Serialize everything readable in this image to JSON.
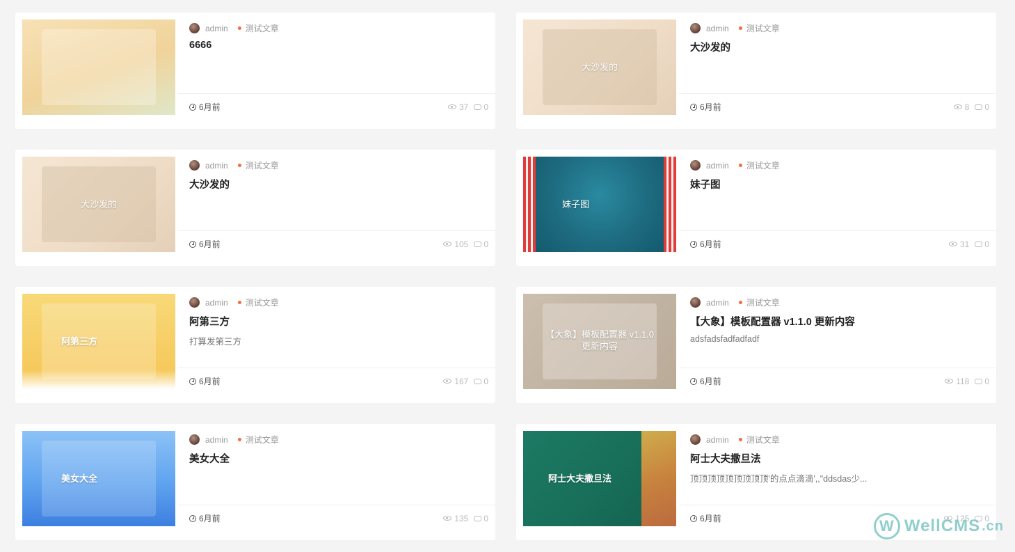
{
  "posts": [
    {
      "thumb_text": "6666",
      "author": "admin",
      "category": "测试文章",
      "title": "6666",
      "excerpt": "",
      "time": "6月前",
      "views": "37",
      "comments": "0",
      "bg": "#f7e1b5",
      "bg2": "#dfe7c8"
    },
    {
      "thumb_text": "大沙发的",
      "author": "admin",
      "category": "测试文章",
      "title": "大沙发的",
      "excerpt": "",
      "time": "6月前",
      "views": "8",
      "comments": "0",
      "bg": "#f5e6d4",
      "bg2": "#eddcc4"
    },
    {
      "thumb_text": "大沙发的",
      "author": "admin",
      "category": "测试文章",
      "title": "大沙发的",
      "excerpt": "",
      "time": "6月前",
      "views": "105",
      "comments": "0",
      "bg": "#f5e6d4",
      "bg2": "#eddcc4"
    },
    {
      "thumb_text": "妹子图",
      "author": "admin",
      "category": "测试文章",
      "title": "妹子图",
      "excerpt": "",
      "time": "6月前",
      "views": "31",
      "comments": "0",
      "bg": "#1e6b80",
      "bg2": "#11566a"
    },
    {
      "thumb_text": "阿第三方",
      "author": "admin",
      "category": "测试文章",
      "title": "阿第三方",
      "excerpt": "打算发第三方",
      "time": "6月前",
      "views": "167",
      "comments": "0",
      "bg": "#f8d978",
      "bg2": "#f6c95c"
    },
    {
      "thumb_text": "【大象】模板配置器 v1.1.0 更新内容",
      "author": "admin",
      "category": "测试文章",
      "title": "【大象】模板配置器 v1.1.0 更新内容",
      "excerpt": "adsfadsfadfadfadf",
      "time": "6月前",
      "views": "118",
      "comments": "0",
      "bg": "#cdbfae",
      "bg2": "#b9ab98"
    },
    {
      "thumb_text": "美女大全",
      "author": "admin",
      "category": "测试文章",
      "title": "美女大全",
      "excerpt": "",
      "time": "6月前",
      "views": "135",
      "comments": "0",
      "bg": "#5fa3ef",
      "bg2": "#3d7fe0"
    },
    {
      "thumb_text": "阿士大夫撒旦法",
      "author": "admin",
      "category": "测试文章",
      "title": "阿士大夫撒旦法",
      "excerpt": "顶顶顶顶顶顶顶顶顶'的点点滴滴',,\"ddsdas少...",
      "time": "6月前",
      "views": "125",
      "comments": "0",
      "bg": "#1d7a64",
      "bg2": "#135f4d"
    }
  ],
  "watermark": {
    "logo_letter": "W",
    "brand": "WellCMS",
    "suffix": ".cn"
  }
}
